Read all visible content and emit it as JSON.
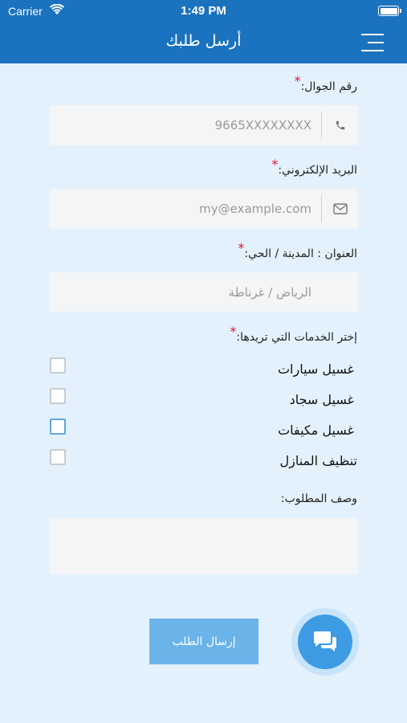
{
  "status_bar": {
    "carrier": "Carrier",
    "time": "1:49 PM"
  },
  "header": {
    "title": "أرسل طلبك",
    "menu_icon": "hamburger-menu-icon"
  },
  "form": {
    "required_mark": "*",
    "phone": {
      "label": "رقم الجوال:",
      "placeholder": "9665XXXXXXXX",
      "icon": "phone-icon"
    },
    "email": {
      "label": "البريد الإلكتروني:",
      "placeholder": "my@example.com",
      "icon": "envelope-icon"
    },
    "address": {
      "label": "العنوان : المدينة / الحي:",
      "placeholder": "الرياض / غرناطة"
    },
    "services": {
      "label": "إختر الخدمات التي تريدها:",
      "options": [
        {
          "label": "غسيل سيارات",
          "checked": false
        },
        {
          "label": "غسيل سجاد",
          "checked": false
        },
        {
          "label": "غسيل مكيفات",
          "checked": false,
          "focused": true
        },
        {
          "label": "تنظيف المنازل",
          "checked": false
        }
      ]
    },
    "description": {
      "label": "وصف المطلوب:",
      "value": ""
    },
    "submit_label": "إرسال الطلب"
  },
  "chat_button": {
    "icon": "chat-bubbles-icon"
  },
  "colors": {
    "header": "#1b72be",
    "background": "#e3f1fc",
    "submit": "#6ab4ea",
    "chat": "#3d9be4",
    "required": "#e0153a"
  }
}
